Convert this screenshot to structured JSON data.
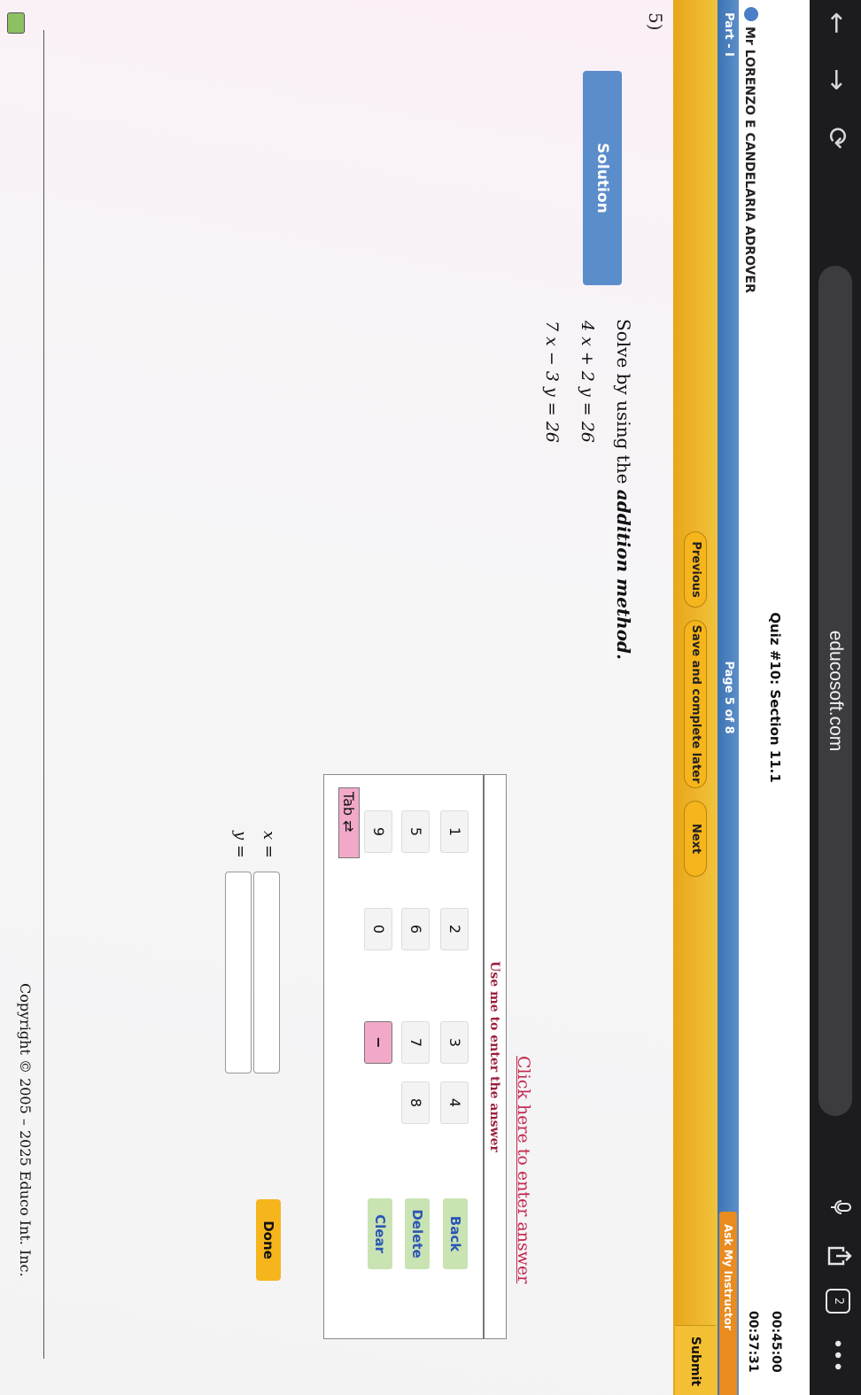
{
  "browser": {
    "url": "educosoft.com",
    "tab_count": "2",
    "back_icon": "←",
    "forward_icon": "→",
    "reload_icon": "⟳",
    "more_icon": "•••"
  },
  "header": {
    "user_name": "Mr LORENZO E CANDELARIA ADROVER",
    "quiz_title": "Quiz #10: Section 11.1",
    "timer_total": "00:45:00",
    "timer_remaining": "00:37:31"
  },
  "part_bar": {
    "part_label": "Part - I",
    "page_label": "Page 5 of 8",
    "ask_label": "Ask My Instructor"
  },
  "nav": {
    "previous": "Previous",
    "save_later": "Save and complete later",
    "next": "Next",
    "submit": "Submit"
  },
  "question": {
    "number": "5)",
    "solution": "Solution",
    "instruction_prefix": "Solve by using the ",
    "instruction_method": "addition method.",
    "equation1": "4 x + 2 y = 26",
    "equation2": "7 x − 3 y = 26"
  },
  "answer": {
    "enter_link": "Click here to enter answer",
    "keypad_title": "Use me to enter the answer",
    "keys_row1": [
      "1",
      "2",
      "3",
      "4"
    ],
    "keys_row2": [
      "5",
      "6",
      "7",
      "8"
    ],
    "keys_row3": [
      "9",
      "0",
      "−"
    ],
    "back": "Back",
    "delete": "Delete",
    "clear": "Clear",
    "tab": "Tab ⇄",
    "x_label": "x =",
    "y_label": "y =",
    "x_value": "",
    "y_value": "",
    "done": "Done"
  },
  "footer": {
    "copyright": "Copyright © 2005 – 2025 Educo Int. Inc."
  }
}
